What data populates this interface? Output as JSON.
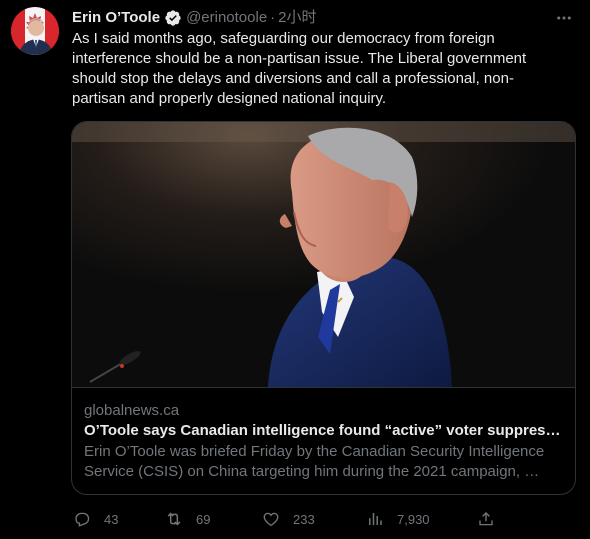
{
  "author": {
    "name": "Erin O’Toole",
    "handle": "@erinotoole",
    "separator": "·",
    "time": "2小时"
  },
  "tweet_text": "As I said months ago, safeguarding our democracy from foreign\ninterference should be a non-partisan issue. The Liberal government\nshould stop the delays and diversions and call a professional, non-\npartisan and properly designed national inquiry.",
  "card": {
    "domain": "globalnews.ca",
    "title": "O’Toole says Canadian intelligence found “active” voter suppression…",
    "description": "Erin O’Toole was briefed Friday by the Canadian Security Intelligence\nService (CSIS) on China targeting him during the 2021 campaign, …"
  },
  "actions": {
    "replies": "43",
    "retweets": "69",
    "likes": "233",
    "views": "7,930"
  },
  "icons": {
    "verified": "verified-badge-icon",
    "more": "more-icon",
    "reply": "reply-icon",
    "retweet": "retweet-icon",
    "like": "heart-icon",
    "views": "views-icon",
    "share": "share-icon"
  },
  "colors": {
    "background": "#000000",
    "text": "#e7e9ea",
    "secondary": "#71767b",
    "border": "#2f3336",
    "verified": "#1d9bf0"
  }
}
